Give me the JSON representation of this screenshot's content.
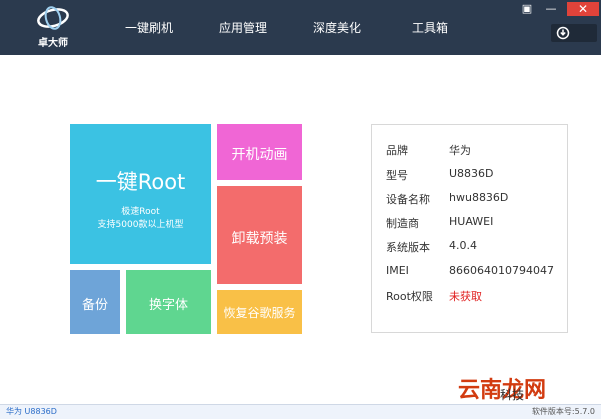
{
  "app": {
    "logo_text": "卓大师"
  },
  "nav": {
    "items": [
      {
        "label": "一键刷机"
      },
      {
        "label": "应用管理"
      },
      {
        "label": "深度美化"
      },
      {
        "label": "工具箱"
      }
    ]
  },
  "window": {
    "menu_glyph": "▣",
    "minimize_glyph": "—",
    "close_glyph": "✕"
  },
  "tiles": {
    "root": {
      "title": "一键Root",
      "sub1": "极速Root",
      "sub2": "支持5000款以上机型"
    },
    "boot_animation": "开机动画",
    "uninstall_preinstalled": "卸载预装",
    "backup": "备份",
    "change_font": "换字体",
    "restore_google": "恢复谷歌服务"
  },
  "colors": {
    "topbar": "#2b3a4e",
    "root_tile": "#3bc2e3",
    "boot_tile": "#f066d5",
    "uninstall_tile": "#f36c6c",
    "backup_tile": "#6ea4d8",
    "font_tile": "#5fd690",
    "google_tile": "#f9c047",
    "root_status": "#e02020"
  },
  "device_info": {
    "rows": [
      {
        "key": "品牌",
        "value": "华为"
      },
      {
        "key": "型号",
        "value": "U8836D"
      },
      {
        "key": "设备名称",
        "value": "hwu8836D"
      },
      {
        "key": "制造商",
        "value": "HUAWEI"
      },
      {
        "key": "系统版本",
        "value": "4.0.4"
      },
      {
        "key": "IMEI",
        "value": "866064010794047"
      },
      {
        "key": "Root权限",
        "value": "未获取"
      }
    ]
  },
  "status": {
    "device": "华为 U8836D",
    "version": "软件版本号:5.7.0"
  },
  "watermark": {
    "main": "云南龙网",
    "sub": "科技"
  }
}
